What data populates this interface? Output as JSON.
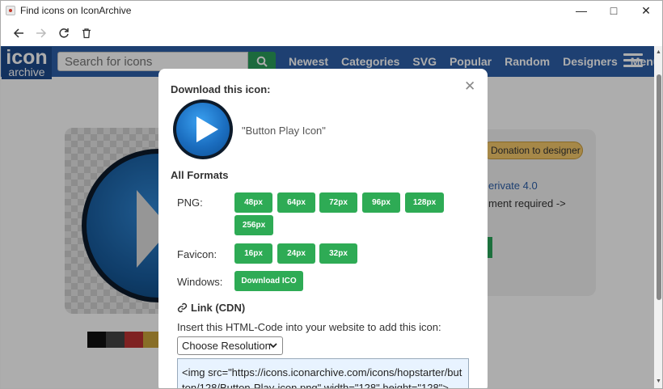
{
  "window": {
    "title": "Find icons on IconArchive"
  },
  "site": {
    "logo_top": "icon",
    "logo_bottom": "archive",
    "search_placeholder": "Search for icons",
    "nav": [
      "Newest",
      "Categories",
      "SVG",
      "Popular",
      "Random",
      "Designers",
      "Menu"
    ]
  },
  "background": {
    "donate_label": "Donation to designer",
    "derivative": "erivate 4.0",
    "attribution": "ment required ->"
  },
  "modal": {
    "title": "Download this icon:",
    "icon_name": "\"Button Play Icon\"",
    "formats_title": "All Formats",
    "png_label": "PNG:",
    "png_sizes": [
      "48px",
      "64px",
      "72px",
      "96px",
      "128px",
      "256px"
    ],
    "favicon_label": "Favicon:",
    "favicon_sizes": [
      "16px",
      "24px",
      "32px"
    ],
    "windows_label": "Windows:",
    "windows_button": "Download ICO",
    "link_title": "Link (CDN)",
    "link_desc": "Insert this HTML-Code into your website to add this icon:",
    "resolution_select": "Choose Resolution",
    "code_snippet": "<img src=\"https://icons.iconarchive.com/icons/hopstarter/button/128/Button-Play-icon.png\" width=\"128\" height=\"128\">"
  },
  "colors": {
    "header_blue": "#2d5fa8",
    "button_green": "#2eab55",
    "donate_yellow": "#f5c96b"
  }
}
